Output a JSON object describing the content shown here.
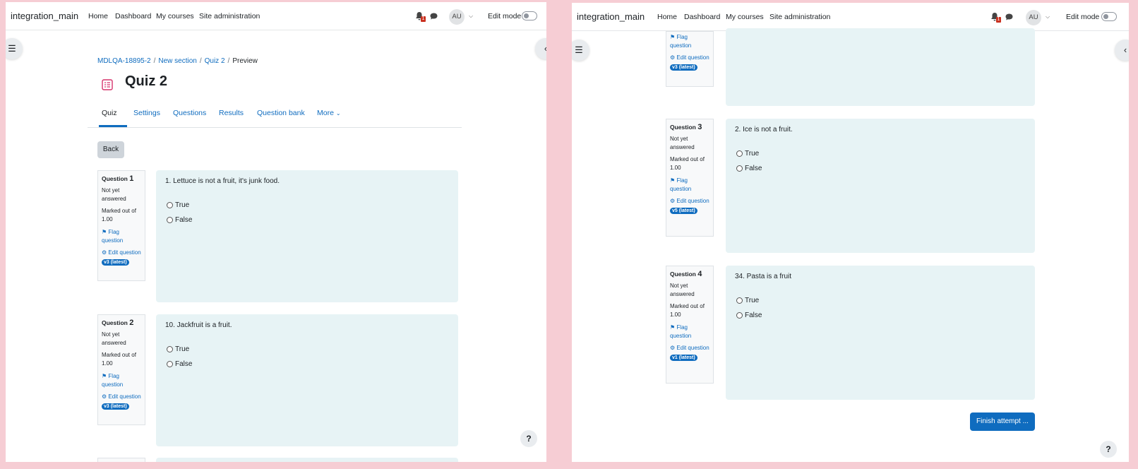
{
  "app": {
    "site_name": "integration_main",
    "nav": [
      "Home",
      "Dashboard",
      "My courses",
      "Site administration"
    ],
    "notification_count": "1",
    "avatar_initials": "AU",
    "edit_mode_label": "Edit mode"
  },
  "breadcrumb": [
    "MDLQA-18895-2",
    "New section",
    "Quiz 2",
    "Preview"
  ],
  "page_title": "Quiz 2",
  "tabs": [
    "Quiz",
    "Settings",
    "Questions",
    "Results",
    "Question bank",
    "More"
  ],
  "back_label": "Back",
  "labels": {
    "question": "Question",
    "state": "Not yet answered",
    "marked": "Marked out of 1.00",
    "flag": "Flag question",
    "edit": "Edit question",
    "option_true": "True",
    "option_false": "False"
  },
  "questions": [
    {
      "number": "1",
      "text": "1. Lettuce is not a fruit, it's junk food.",
      "version": "v3 (latest)"
    },
    {
      "number": "2",
      "text": "10. Jackfruit is a fruit.",
      "version": "v3 (latest)"
    },
    {
      "number": "3",
      "text": "2. Ice is not a fruit.",
      "version": "v5 (latest)"
    },
    {
      "number": "4",
      "text": "34. Pasta is a fruit",
      "version": "v1 (latest)"
    }
  ],
  "partial_question": {
    "version": "v3 (latest)"
  },
  "finish_label": "Finish attempt ...",
  "help_label": "?",
  "colors": {
    "accent": "#0f6cbf",
    "question_bg": "#e7f3f5",
    "frame": "#f6cdd4"
  }
}
